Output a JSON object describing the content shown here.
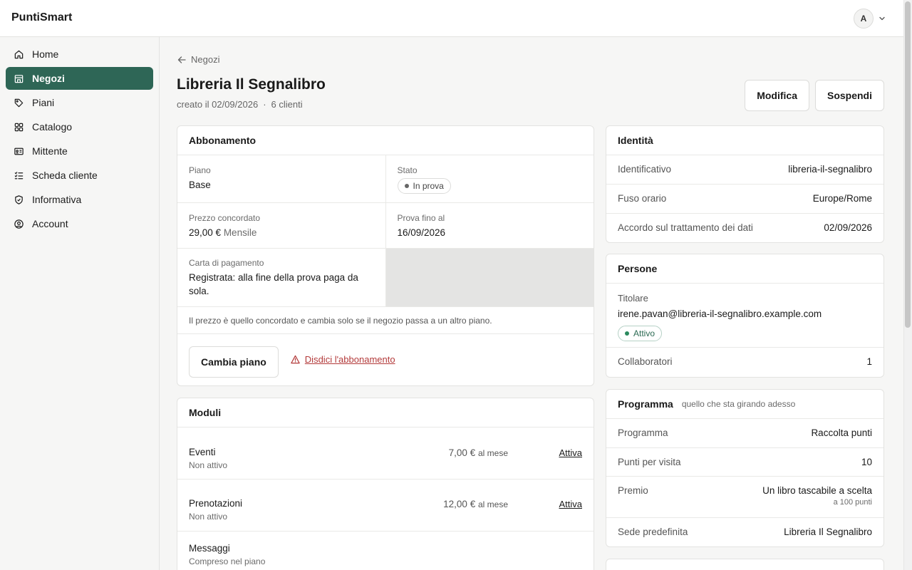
{
  "app": {
    "brand": "PuntiSmart",
    "user_initial": "A"
  },
  "sidebar": {
    "items": [
      {
        "label": "Home",
        "icon": "home-icon"
      },
      {
        "label": "Negozi",
        "icon": "store-icon",
        "active": true
      },
      {
        "label": "Piani",
        "icon": "tag-icon"
      },
      {
        "label": "Catalogo",
        "icon": "grid-icon"
      },
      {
        "label": "Mittente",
        "icon": "id-card-icon"
      },
      {
        "label": "Scheda cliente",
        "icon": "checklist-icon"
      },
      {
        "label": "Informativa",
        "icon": "shield-icon"
      },
      {
        "label": "Account",
        "icon": "user-circle-icon"
      }
    ]
  },
  "page": {
    "breadcrumb": "Negozi",
    "title": "Libreria Il Segnalibro",
    "created": "creato il 02/09/2026",
    "sep": "·",
    "clients": "6 clienti",
    "actions": {
      "edit": "Modifica",
      "suspend": "Sospendi"
    }
  },
  "subscription": {
    "title": "Abbonamento",
    "plan_label": "Piano",
    "plan_value": "Base",
    "status_label": "Stato",
    "status_value": "In prova",
    "price_label": "Prezzo concordato",
    "price_value": "29,00 €",
    "price_period": "Mensile",
    "trial_label": "Prova fino al",
    "trial_value": "16/09/2026",
    "card_label": "Carta di pagamento",
    "card_value": "Registrata: alla fine della prova paga da sola.",
    "note": "Il prezzo è quello concordato e cambia solo se il negozio passa a un altro piano.",
    "change_plan": "Cambia piano",
    "cancel": "Disdici l'abbonamento"
  },
  "modules": {
    "title": "Moduli",
    "items": [
      {
        "name": "Eventi",
        "status": "Non attivo",
        "price": "7,00 €",
        "period": "al mese",
        "action": "Attiva"
      },
      {
        "name": "Prenotazioni",
        "status": "Non attivo",
        "price": "12,00 €",
        "period": "al mese",
        "action": "Attiva"
      },
      {
        "name": "Messaggi",
        "status": "Compreso nel piano"
      }
    ]
  },
  "identity": {
    "title": "Identità",
    "rows": [
      {
        "k": "Identificativo",
        "v": "libreria-il-segnalibro"
      },
      {
        "k": "Fuso orario",
        "v": "Europe/Rome"
      },
      {
        "k": "Accordo sul trattamento dei dati",
        "v": "02/09/2026"
      }
    ]
  },
  "people": {
    "title": "Persone",
    "owner_label": "Titolare",
    "owner_email": "irene.pavan@libreria-il-segnalibro.example.com",
    "owner_status": "Attivo",
    "collab_label": "Collaboratori",
    "collab_value": "1"
  },
  "program": {
    "title": "Programma",
    "hint": "quello che sta girando adesso",
    "rows": [
      {
        "k": "Programma",
        "v": "Raccolta punti"
      },
      {
        "k": "Punti per visita",
        "v": "10"
      },
      {
        "k": "Premio",
        "v": "Un libro tascabile a scelta",
        "sub": "a 100 punti"
      },
      {
        "k": "Sede predefinita",
        "v": "Libreria Il Segnalibro"
      }
    ]
  },
  "colors": {
    "accent": "#2e6656",
    "danger": "#b33a3a",
    "success": "#2b8a5e"
  }
}
